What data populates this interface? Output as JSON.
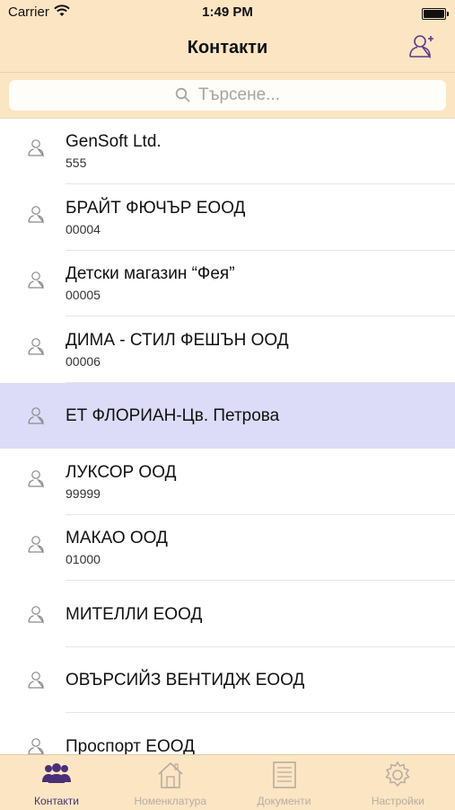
{
  "status_bar": {
    "carrier": "Carrier",
    "time": "1:49 PM",
    "battery_level": 1.0
  },
  "nav": {
    "title": "Контакти",
    "add_contact_icon": "add-contact-icon"
  },
  "search": {
    "placeholder": "Търсене..."
  },
  "contacts": [
    {
      "name": "GenSoft Ltd.",
      "code": "555",
      "selected": false
    },
    {
      "name": "БРАЙТ ФЮЧЪР ЕООД",
      "code": "00004",
      "selected": false
    },
    {
      "name": "Детски магазин “Фея”",
      "code": "00005",
      "selected": false
    },
    {
      "name": "ДИМА - СТИЛ ФЕШЪН ООД",
      "code": "00006",
      "selected": false
    },
    {
      "name": "ЕТ ФЛОРИАН-Цв. Петрова",
      "code": "",
      "selected": true
    },
    {
      "name": "ЛУКСОР ООД",
      "code": "99999",
      "selected": false
    },
    {
      "name": "МАКАО ООД",
      "code": "01000",
      "selected": false
    },
    {
      "name": "МИТЕЛЛИ ЕООД",
      "code": "",
      "selected": false
    },
    {
      "name": "ОВЪРСИЙЗ ВЕНТИДЖ ЕООД",
      "code": "",
      "selected": false
    },
    {
      "name": "Проспорт ЕООД",
      "code": "",
      "selected": false
    }
  ],
  "tabs": [
    {
      "label": "Контакти",
      "icon": "people-icon",
      "active": true
    },
    {
      "label": "Номенклатура",
      "icon": "home-icon",
      "active": false
    },
    {
      "label": "Документи",
      "icon": "document-icon",
      "active": false
    },
    {
      "label": "Настройки",
      "icon": "gear-icon",
      "active": false
    }
  ],
  "colors": {
    "bar_background": "#fce5c3",
    "selected_row": "#dcdcf8",
    "accent": "#4a2e78",
    "inactive_tab": "#b7aca0"
  }
}
